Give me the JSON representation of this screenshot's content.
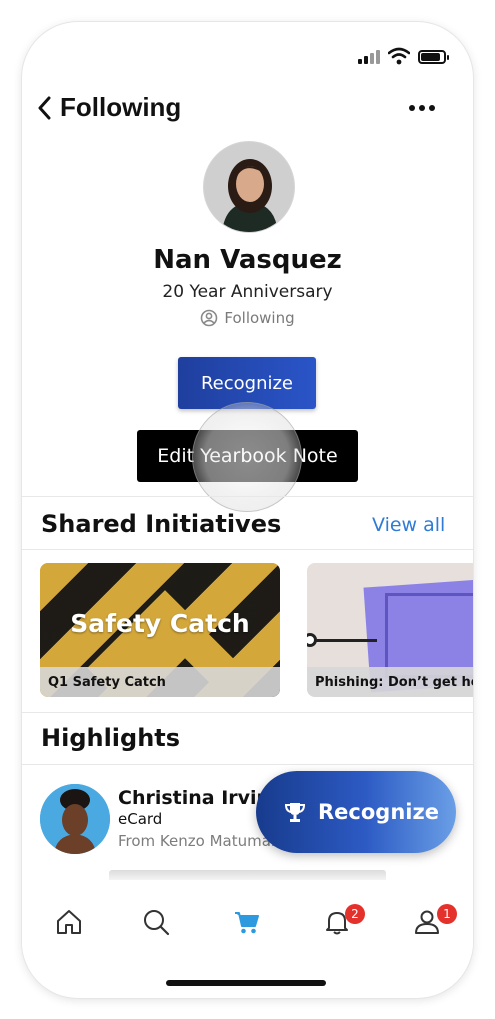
{
  "header": {
    "title": "Following",
    "more_icon": "more-horizontal-icon",
    "back_icon": "chevron-left-icon"
  },
  "profile": {
    "name": "Nan Vasquez",
    "subtitle": "20 Year Anniversary",
    "status": "Following"
  },
  "actions": {
    "recognize_label": "Recognize",
    "yearbook_label": "Edit Yearbook Note"
  },
  "shared_initiatives": {
    "title": "Shared Initiatives",
    "view_all": "View all",
    "cards": [
      {
        "image_text": "Safety Catch",
        "caption": "Q1 Safety Catch"
      },
      {
        "caption": "Phishing: Don’t get hook"
      }
    ]
  },
  "highlights": {
    "title": "Highlights",
    "items": [
      {
        "name": "Christina Irvin",
        "type": "eCard",
        "from": "From Kenzo Matumar"
      }
    ]
  },
  "fab": {
    "label": "Recognize",
    "icon": "trophy-icon"
  },
  "tabbar": {
    "items": [
      {
        "name": "home",
        "icon": "home-icon"
      },
      {
        "name": "search",
        "icon": "search-icon"
      },
      {
        "name": "shop",
        "icon": "cart-icon"
      },
      {
        "name": "notifications",
        "icon": "bell-icon",
        "badge": "2"
      },
      {
        "name": "profile",
        "icon": "user-icon",
        "badge": "1"
      }
    ]
  },
  "colors": {
    "accent": "#2f7bd6",
    "primary_button": "#2a55c8",
    "badge": "#e4312b",
    "cart_active": "#2d9ae0"
  }
}
